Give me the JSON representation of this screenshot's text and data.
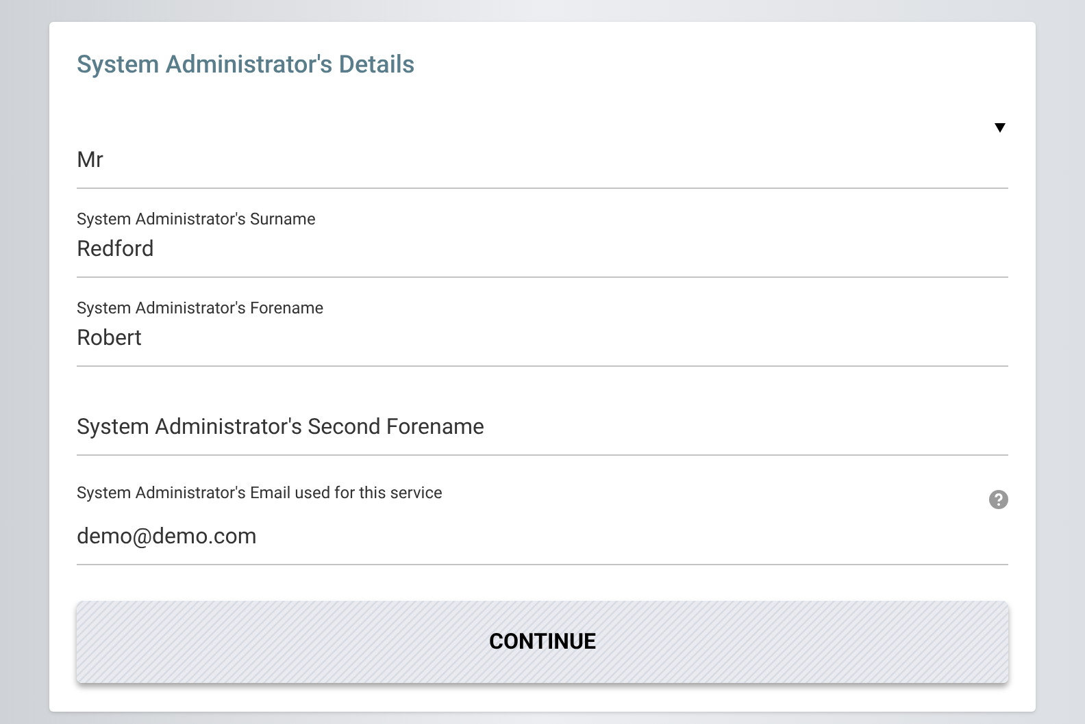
{
  "form": {
    "title": "System Administrator's Details",
    "fields": [
      {
        "kind": "select",
        "value": "Mr"
      },
      {
        "kind": "text",
        "label": "System Administrator's Surname",
        "value": "Redford"
      },
      {
        "kind": "text",
        "label": "System Administrator's Forename",
        "value": "Robert"
      },
      {
        "kind": "text",
        "placeholder": "System Administrator's Second Forename"
      },
      {
        "kind": "text",
        "label": "System Administrator's Email used for this service",
        "value": "demo@demo.com",
        "help": true
      }
    ],
    "button": "CONTINUE"
  }
}
